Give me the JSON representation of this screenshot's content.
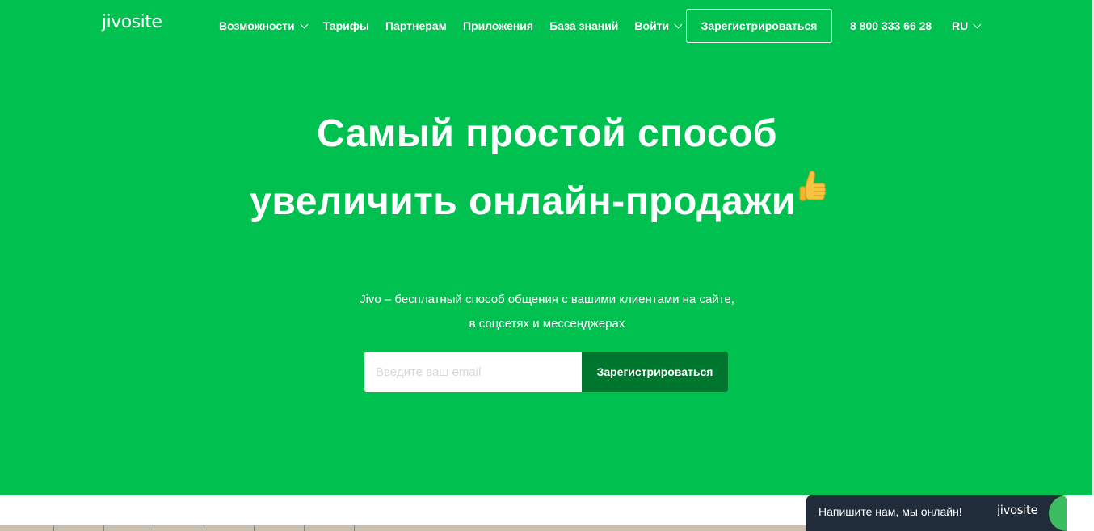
{
  "colors": {
    "hero_bg": "#00c050",
    "submit_bg": "#00772f",
    "chat_bg": "#212c3a",
    "chat_accent": "#3dbb60"
  },
  "header": {
    "logo_text": "jivosite",
    "nav": [
      {
        "label": "Возможности",
        "dropdown": true
      },
      {
        "label": "Тарифы",
        "dropdown": false
      },
      {
        "label": "Партнерам",
        "dropdown": false
      },
      {
        "label": "Приложения",
        "dropdown": false
      },
      {
        "label": "База знаний",
        "dropdown": false
      },
      {
        "label": "Войти",
        "dropdown": true
      }
    ],
    "register_label": "Зарегистрироваться",
    "phone": "8 800 333 66 28",
    "lang": "RU"
  },
  "hero": {
    "title_line1": "Самый простой способ",
    "title_line2": "увеличить онлайн-продажи",
    "title_icon": "thumbs-up-emoji",
    "subtitle_line1": "Jivo – бесплатный способ общения с вашими клиентами на сайте,",
    "subtitle_line2": "в соцсетях и мессенджерах",
    "email_placeholder": "Введите ваш email",
    "email_value": "",
    "submit_label": "Зарегистрироваться"
  },
  "chat_widget": {
    "text": "Напишите нам, мы онлайн!",
    "logo_text": "jivosite"
  }
}
